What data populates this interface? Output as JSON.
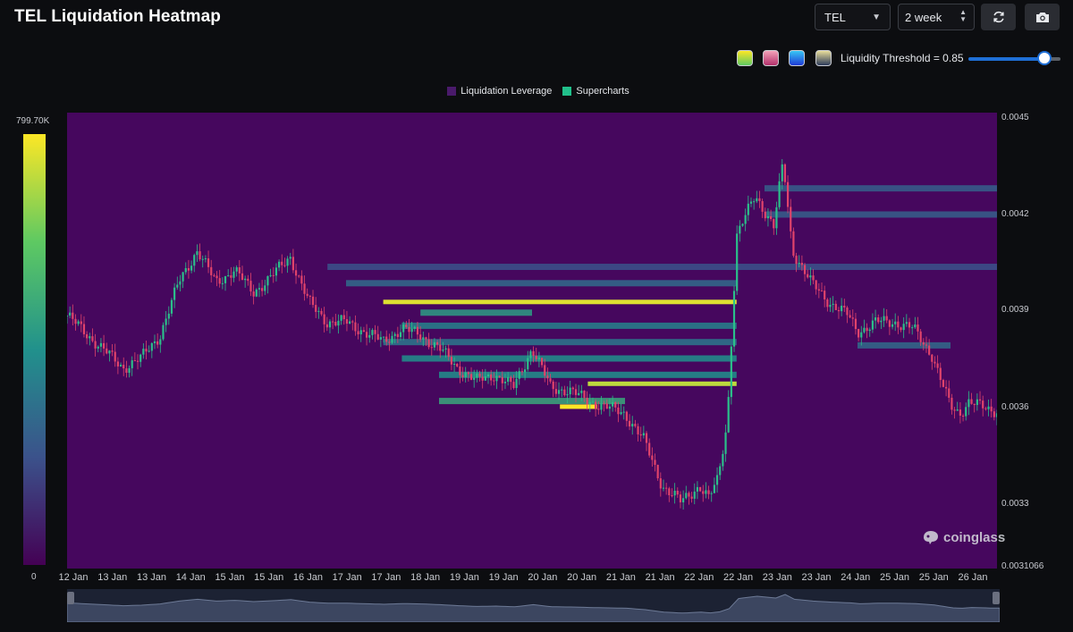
{
  "header": {
    "title": "TEL Liquidation Heatmap",
    "symbol": "TEL",
    "range": "2 week",
    "refresh_icon": "refresh-icon",
    "screenshot_icon": "camera-icon"
  },
  "controls": {
    "palettes": [
      {
        "name": "viridis",
        "from": "#5ec962",
        "to": "#fde725"
      },
      {
        "name": "rose",
        "from": "#b3306b",
        "to": "#f2a2b8"
      },
      {
        "name": "blue",
        "from": "#1f3bd6",
        "to": "#38c6f4"
      },
      {
        "name": "slate",
        "from": "#2c3a5a",
        "to": "#e8dd9a"
      }
    ],
    "threshold_label": "Liquidity Threshold = 0.85",
    "threshold_value": 0.85
  },
  "chart_data": {
    "type": "heatmap",
    "title": "TEL Liquidation Heatmap",
    "legend": [
      {
        "name": "Liquidation Leverage",
        "color": "#4a1a6b"
      },
      {
        "name": "Supercharts",
        "color": "#21c08b"
      }
    ],
    "colorscale": {
      "min_label": "0",
      "max_label": "799.70K",
      "max": 799700,
      "colors": [
        "#440154",
        "#3b528b",
        "#21918c",
        "#5ec962",
        "#fde725"
      ]
    },
    "ylim": [
      0.0031066,
      0.0045
    ],
    "y_ticks": [
      "0.0045",
      "0.0042",
      "0.0039",
      "0.0036",
      "0.0033",
      "0.0031066"
    ],
    "x_ticks": [
      "12 Jan",
      "13 Jan",
      "13 Jan",
      "14 Jan",
      "15 Jan",
      "15 Jan",
      "16 Jan",
      "17 Jan",
      "17 Jan",
      "18 Jan",
      "19 Jan",
      "19 Jan",
      "20 Jan",
      "20 Jan",
      "21 Jan",
      "21 Jan",
      "22 Jan",
      "22 Jan",
      "23 Jan",
      "23 Jan",
      "24 Jan",
      "25 Jan",
      "25 Jan",
      "26 Jan"
    ],
    "price_path": [
      [
        0,
        0.00388
      ],
      [
        3,
        0.0038
      ],
      [
        6,
        0.00372
      ],
      [
        8,
        0.00375
      ],
      [
        10,
        0.00382
      ],
      [
        12,
        0.00398
      ],
      [
        14,
        0.00408
      ],
      [
        16,
        0.00398
      ],
      [
        18,
        0.00402
      ],
      [
        20,
        0.00395
      ],
      [
        22,
        0.004
      ],
      [
        24,
        0.00406
      ],
      [
        26,
        0.00392
      ],
      [
        28,
        0.00386
      ],
      [
        30,
        0.00386
      ],
      [
        32,
        0.00383
      ],
      [
        34,
        0.0038
      ],
      [
        36,
        0.00384
      ],
      [
        38,
        0.00382
      ],
      [
        40,
        0.00378
      ],
      [
        42,
        0.00372
      ],
      [
        44,
        0.00368
      ],
      [
        46,
        0.0037
      ],
      [
        48,
        0.00366
      ],
      [
        50,
        0.00378
      ],
      [
        52,
        0.00366
      ],
      [
        54,
        0.00365
      ],
      [
        56,
        0.00362
      ],
      [
        58,
        0.0036
      ],
      [
        60,
        0.00358
      ],
      [
        62,
        0.0035
      ],
      [
        64,
        0.00336
      ],
      [
        66,
        0.00331
      ],
      [
        68,
        0.00336
      ],
      [
        69,
        0.00332
      ],
      [
        70,
        0.00338
      ],
      [
        71,
        0.00356
      ],
      [
        72,
        0.00412
      ],
      [
        74,
        0.00425
      ],
      [
        76,
        0.00415
      ],
      [
        77,
        0.00435
      ],
      [
        78,
        0.00408
      ],
      [
        80,
        0.00398
      ],
      [
        82,
        0.00392
      ],
      [
        84,
        0.00388
      ],
      [
        85,
        0.00383
      ],
      [
        87,
        0.00386
      ],
      [
        89,
        0.00386
      ],
      [
        91,
        0.00384
      ],
      [
        93,
        0.00376
      ],
      [
        95,
        0.0036
      ],
      [
        96,
        0.00358
      ],
      [
        97,
        0.00362
      ],
      [
        99,
        0.00359
      ]
    ],
    "liquidity_bands": [
      {
        "price": 0.00392,
        "x_start": 34,
        "x_end": 72,
        "intensity": 0.95
      },
      {
        "price": 0.00367,
        "x_start": 56,
        "x_end": 72,
        "intensity": 0.9
      },
      {
        "price": 0.0036,
        "x_start": 53,
        "x_end": 57,
        "intensity": 1.0
      },
      {
        "price": 0.00389,
        "x_start": 38,
        "x_end": 50,
        "intensity": 0.55
      },
      {
        "price": 0.00375,
        "x_start": 36,
        "x_end": 72,
        "intensity": 0.5
      },
      {
        "price": 0.00385,
        "x_start": 36,
        "x_end": 72,
        "intensity": 0.45
      },
      {
        "price": 0.00362,
        "x_start": 40,
        "x_end": 60,
        "intensity": 0.6
      },
      {
        "price": 0.0037,
        "x_start": 40,
        "x_end": 72,
        "intensity": 0.5
      },
      {
        "price": 0.0038,
        "x_start": 34,
        "x_end": 72,
        "intensity": 0.4
      },
      {
        "price": 0.00398,
        "x_start": 30,
        "x_end": 72,
        "intensity": 0.35
      },
      {
        "price": 0.00403,
        "x_start": 28,
        "x_end": 100,
        "intensity": 0.25
      },
      {
        "price": 0.00427,
        "x_start": 75,
        "x_end": 100,
        "intensity": 0.3
      },
      {
        "price": 0.00419,
        "x_start": 75,
        "x_end": 100,
        "intensity": 0.3
      },
      {
        "price": 0.00379,
        "x_start": 85,
        "x_end": 95,
        "intensity": 0.35
      }
    ]
  },
  "branding": {
    "text": "coinglass"
  }
}
